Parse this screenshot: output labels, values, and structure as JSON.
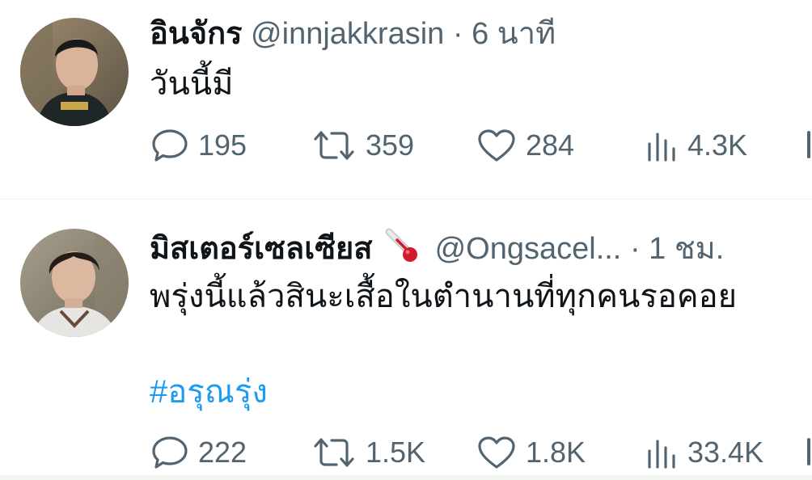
{
  "tweets": [
    {
      "name": "อินจักร",
      "handle": "@innjakkrasin",
      "separator": "·",
      "time": "6 นาที",
      "text": "วันนี้มี",
      "hashtag": "",
      "stats": {
        "replies": "195",
        "retweets": "359",
        "likes": "284",
        "views": "4.3K"
      }
    },
    {
      "name": "มิสเตอร์เซลเซียส",
      "name_emoji": "thermometer",
      "handle": "@Ongsacel...",
      "separator": "·",
      "time": "1 ชม.",
      "text": "พรุ่งนี้แล้วสินะเสื้อในตำนานที่ทุกคนรอคอย",
      "hashtag": "#อรุณรุ่ง",
      "stats": {
        "replies": "222",
        "retweets": "1.5K",
        "likes": "1.8K",
        "views": "33.4K"
      }
    }
  ],
  "colors": {
    "text": "#0f1419",
    "muted": "#536471",
    "link": "#1d9bf0",
    "divider": "#eff3f4"
  },
  "icons": [
    "reply-icon",
    "retweet-icon",
    "like-icon",
    "views-icon",
    "share-icon"
  ]
}
